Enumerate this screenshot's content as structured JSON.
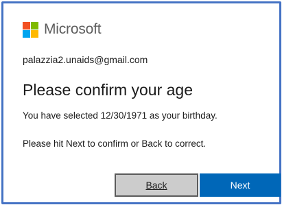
{
  "brand": {
    "name": "Microsoft",
    "logo_colors": [
      "#f25022",
      "#7fba00",
      "#00a4ef",
      "#ffb900"
    ]
  },
  "account": {
    "email": "palazzia2.unaids@gmail.com"
  },
  "main": {
    "title": "Please confirm your age",
    "birthday_message": "You have selected 12/30/1971 as your birthday.",
    "instruction": "Please hit Next to confirm or Back to correct."
  },
  "buttons": {
    "back_label": "Back",
    "next_label": "Next"
  },
  "colors": {
    "frame_border": "#4472c4",
    "primary_button": "#0067b8",
    "secondary_button": "#cccccc"
  }
}
